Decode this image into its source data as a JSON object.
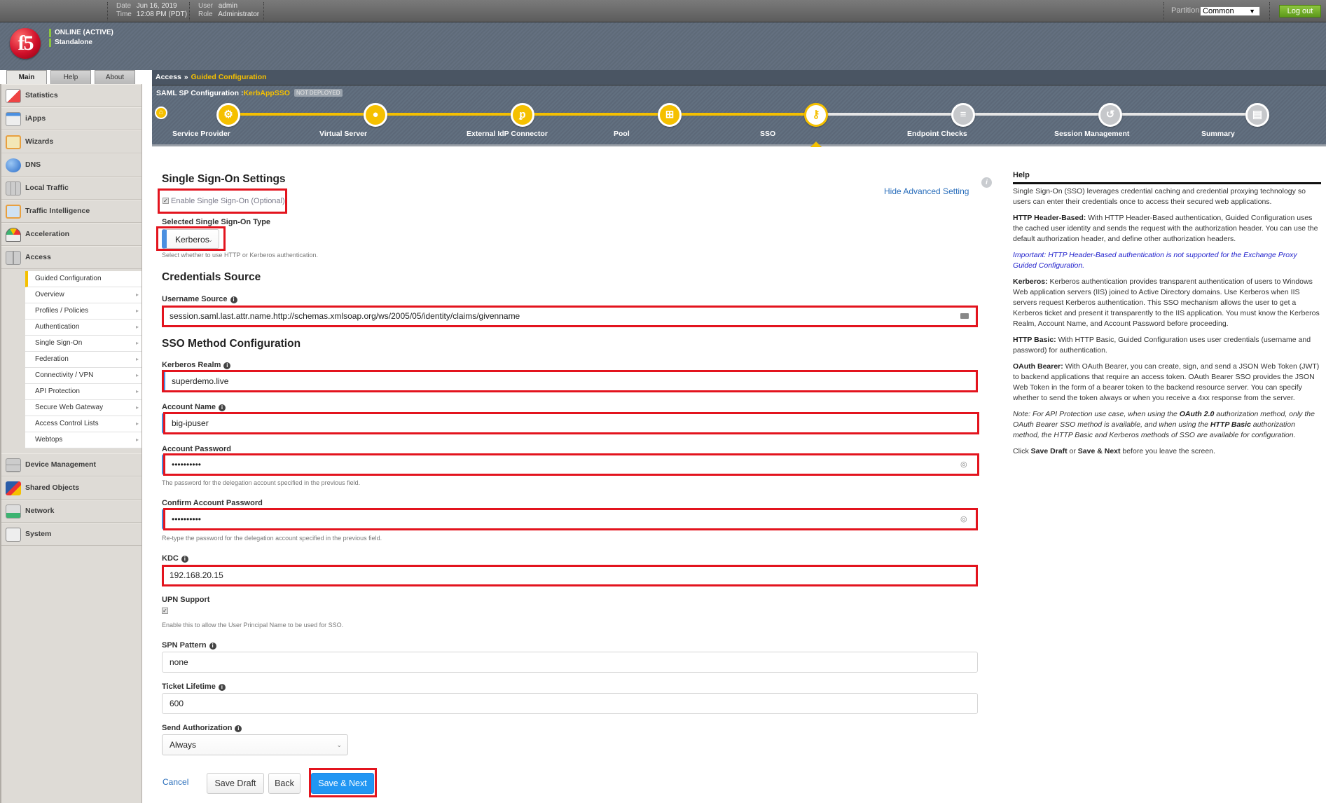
{
  "topbar": {
    "date_label": "Date",
    "date_value": "Jun 16, 2019",
    "time_label": "Time",
    "time_value": "12:08 PM (PDT)",
    "user_label": "User",
    "user_value": "admin",
    "role_label": "Role",
    "role_value": "Administrator",
    "partition_label": "Partition:",
    "partition_value": "Common",
    "logout_label": "Log out"
  },
  "header": {
    "logo_text": "f5",
    "status": "ONLINE (ACTIVE)",
    "mode": "Standalone"
  },
  "nav_tabs": [
    "Main",
    "Help",
    "About"
  ],
  "nav": {
    "items": [
      {
        "label": "Statistics",
        "icon": "statistics-icon"
      },
      {
        "label": "iApps",
        "icon": "iapps-icon"
      },
      {
        "label": "Wizards",
        "icon": "wizards-icon"
      },
      {
        "label": "DNS",
        "icon": "dns-globe-icon"
      },
      {
        "label": "Local Traffic",
        "icon": "local-traffic-icon"
      },
      {
        "label": "Traffic Intelligence",
        "icon": "traffic-intelligence-icon"
      },
      {
        "label": "Acceleration",
        "icon": "acceleration-gauge-icon"
      },
      {
        "label": "Access",
        "icon": "access-icon"
      }
    ],
    "sub_items": [
      {
        "label": "Guided Configuration",
        "active": true
      },
      {
        "label": "Overview"
      },
      {
        "label": "Profiles / Policies"
      },
      {
        "label": "Authentication"
      },
      {
        "label": "Single Sign-On"
      },
      {
        "label": "Federation"
      },
      {
        "label": "Connectivity / VPN"
      },
      {
        "label": "API Protection"
      },
      {
        "label": "Secure Web Gateway"
      },
      {
        "label": "Access Control Lists"
      },
      {
        "label": "Webtops"
      }
    ],
    "bottom_items": [
      {
        "label": "Device Management",
        "icon": "device-management-icon"
      },
      {
        "label": "Shared Objects",
        "icon": "shared-objects-icon"
      },
      {
        "label": "Network",
        "icon": "network-icon"
      },
      {
        "label": "System",
        "icon": "system-icon"
      }
    ]
  },
  "breadcrumb": {
    "root": "Access",
    "separator": "»",
    "current": "Guided Configuration"
  },
  "config": {
    "title": "SAML SP Configuration :",
    "name": "KerbAppSSO",
    "badge": "NOT DEPLOYED"
  },
  "steps": [
    {
      "label": "Service Provider",
      "state": "done",
      "icon": "⚙"
    },
    {
      "label": "Virtual Server",
      "state": "done",
      "icon": "●"
    },
    {
      "label": "External IdP Connector",
      "state": "done",
      "icon": "ᵱ"
    },
    {
      "label": "Pool",
      "state": "done",
      "icon": "⊞"
    },
    {
      "label": "SSO",
      "state": "current",
      "icon": "⚷"
    },
    {
      "label": "Endpoint Checks",
      "state": "pending",
      "icon": "≡"
    },
    {
      "label": "Session Management",
      "state": "pending",
      "icon": "↺"
    },
    {
      "label": "Summary",
      "state": "pending",
      "icon": "▤"
    }
  ],
  "colors": {
    "accent_yellow": "#f5c000",
    "highlight_red": "#e3141e",
    "primary_blue": "#2196f3",
    "required_bar": "#4a8fe0"
  },
  "form": {
    "sso_settings_heading": "Single Sign-On Settings",
    "hide_advanced": "Hide Advanced Setting",
    "enable_sso_label": "Enable Single Sign-On (Optional)",
    "enable_sso_checked": true,
    "sso_type_label": "Selected Single Sign-On Type",
    "sso_type_value": "Kerberos",
    "sso_type_hint": "Select whether to use HTTP or Kerberos authentication.",
    "credentials_heading": "Credentials Source",
    "username_source_label": "Username Source",
    "username_source_value": "session.saml.last.attr.name.http://schemas.xmlsoap.org/ws/2005/05/identity/claims/givenname",
    "sso_method_heading": "SSO Method Configuration",
    "kerberos_realm_label": "Kerberos Realm",
    "kerberos_realm_value": "superdemo.live",
    "account_name_label": "Account Name",
    "account_name_value": "big-ipuser",
    "account_password_label": "Account Password",
    "account_password_value": "••••••••••",
    "account_password_hint": "The password for the delegation account specified in the previous field.",
    "confirm_password_label": "Confirm Account Password",
    "confirm_password_value": "••••••••••",
    "confirm_password_hint": "Re-type the password for the delegation account specified in the previous field.",
    "kdc_label": "KDC",
    "kdc_value": "192.168.20.15",
    "upn_label": "UPN Support",
    "upn_checked": true,
    "upn_hint": "Enable this to allow the User Principal Name to be used for SSO.",
    "spn_label": "SPN Pattern",
    "spn_value": "none",
    "ticket_lifetime_label": "Ticket Lifetime",
    "ticket_lifetime_value": "600",
    "send_auth_label": "Send Authorization",
    "send_auth_value": "Always"
  },
  "actions": {
    "cancel": "Cancel",
    "save_draft": "Save Draft",
    "back": "Back",
    "save_next": "Save & Next"
  },
  "help": {
    "title": "Help",
    "intro": "Single Sign-On (SSO) leverages credential caching and credential proxying technology so users can enter their credentials once to access their secured web applications.",
    "header_based_term": "HTTP Header-Based:",
    "header_based_text": " With HTTP Header-Based authentication, Guided Configuration uses the cached user identity and sends the request with the authorization header. You can use the default authorization header, and define other authorization headers.",
    "important": "Important: HTTP Header-Based authentication is not supported for the Exchange Proxy Guided Configuration.",
    "kerberos_term": "Kerberos:",
    "kerberos_text": " Kerberos authentication provides transparent authentication of users to Windows Web application servers (IIS) joined to Active Directory domains. Use Kerberos when IIS servers request Kerberos authentication. This SSO mechanism allows the user to get a Kerberos ticket and present it transparently to the IIS application. You must know the Kerberos Realm, Account Name, and Account Password before proceeding.",
    "basic_term": "HTTP Basic:",
    "basic_text": " With HTTP Basic, Guided Configuration uses user credentials (username and password) for authentication.",
    "oauth_term": "OAuth Bearer:",
    "oauth_text": " With OAuth Bearer, you can create, sign, and send a JSON Web Token (JWT) to backend applications that require an access token. OAuth Bearer SSO provides the JSON Web Token in the form of a bearer token to the backend resource server. You can specify whether to send the token always or when you receive a 4xx response from the server.",
    "note_a": "Note: For API Protection use case, when using the ",
    "note_b": "OAuth 2.0",
    "note_c": " authorization method, only the OAuth Bearer SSO method is available, and when using the ",
    "note_d": "HTTP Basic",
    "note_e": " authorization method, the HTTP Basic and Kerberos methods of SSO are available for configuration.",
    "click_a": "Click ",
    "click_b": "Save Draft",
    "click_c": " or ",
    "click_d": "Save & Next",
    "click_e": " before you leave the screen."
  }
}
